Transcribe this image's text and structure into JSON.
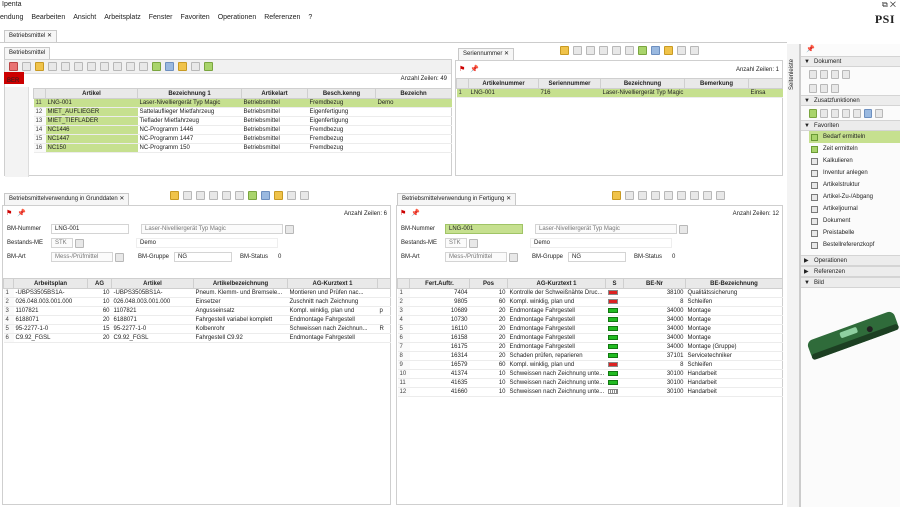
{
  "app": {
    "title": "Ipenta",
    "logo": "PSI"
  },
  "menu": [
    "endung",
    "Bearbeiten",
    "Ansicht",
    "Arbeitsplatz",
    "Fenster",
    "Favoriten",
    "Operationen",
    "Referenzen",
    "?"
  ],
  "main_tab": "Betriebsmittel",
  "top_left": {
    "subtab": "Betriebsmittel",
    "row_count": "Anzahl Zeilen: 49",
    "side_label": "BER",
    "columns": [
      "",
      "Artikel",
      "Bezeichnung 1",
      "Artikelart",
      "Besch.kenng",
      "Bezeichn"
    ],
    "rows": [
      {
        "n": "11",
        "a": "LNG-001",
        "b": "Laser-Nivelliergerät Typ Magic",
        "c": "Betriebsmittel",
        "d": "Fremdbezug",
        "e": "Demo",
        "sel": true
      },
      {
        "n": "12",
        "a": "MIET_AUFLIEGER",
        "b": "Sattelauflieger Mietfahrzeug",
        "c": "Betriebsmittel",
        "d": "Eigenfertigung",
        "e": ""
      },
      {
        "n": "13",
        "a": "MIET_TIEFLADER",
        "b": "Tieflader Mietfahrzeug",
        "c": "Betriebsmittel",
        "d": "Eigenfertigung",
        "e": ""
      },
      {
        "n": "14",
        "a": "NC1446",
        "b": "NC-Programm 1446",
        "c": "Betriebsmittel",
        "d": "Fremdbezug",
        "e": ""
      },
      {
        "n": "15",
        "a": "NC1447",
        "b": "NC-Programm 1447",
        "c": "Betriebsmittel",
        "d": "Fremdbezug",
        "e": ""
      },
      {
        "n": "16",
        "a": "NC150",
        "b": "NC-Programm 150",
        "c": "Betriebsmittel",
        "d": "Fremdbezug",
        "e": ""
      }
    ]
  },
  "top_right": {
    "subtab": "Seriennummer",
    "row_count": "Anzahl Zeilen: 1",
    "columns": [
      "",
      "Artikelnummer",
      "Seriennummer",
      "Bezeichnung",
      "Bemerkung",
      ""
    ],
    "rows": [
      {
        "n": "1",
        "a": "LNG-001",
        "b": "716",
        "c": "Laser-Nivelliergerät Typ Magic",
        "d": "",
        "e": "Einsa"
      }
    ]
  },
  "bottom_left": {
    "subtab": "Betriebsmittelverwendung in Grunddaten",
    "row_count": "Anzahl Zeilen: 6",
    "form": {
      "bm_nummer_label": "BM-Nummer",
      "bm_nummer": "LNG-001",
      "bez": "Laser-Nivelliergerät Typ Magic",
      "bestands_label": "Bestands-ME",
      "bestands": "STK",
      "demo": "Demo",
      "bm_art_label": "BM-Art",
      "bm_art": "Mess-/Prüfmittel",
      "bm_gruppe_label": "BM-Gruppe",
      "bm_gruppe": "NG",
      "bm_status_label": "BM-Status",
      "bm_status": "0"
    },
    "columns": [
      "",
      "Arbeitsplan",
      "AG",
      "Artikel",
      "Artikelbezeichnung",
      "AG-Kurztext 1",
      ""
    ],
    "rows": [
      {
        "n": "1",
        "a": "-UBPS3505BS1A-",
        "b": "10",
        "c": "-UBPS3505BS1A-",
        "d": "Pneum. Klemm- und Bremsele...",
        "e": "Montieren und Prüfen nac...",
        "f": ""
      },
      {
        "n": "2",
        "a": "026.048.003.001.000",
        "b": "10",
        "c": "026.048.003.001.000",
        "d": "Einsetzer",
        "e": "Zuschnitt nach Zeichnung",
        "f": ""
      },
      {
        "n": "3",
        "a": "1107821",
        "b": "60",
        "c": "1107821",
        "d": "Angusseinsatz",
        "e": "Kompl. winklig, plan und",
        "f": "p"
      },
      {
        "n": "4",
        "a": "6188071",
        "b": "20",
        "c": "6188071",
        "d": "Fahrgestell variabel komplett",
        "e": "Endmontage Fahrgestell",
        "f": ""
      },
      {
        "n": "5",
        "a": "95-2277-1-0",
        "b": "15",
        "c": "95-2277-1-0",
        "d": "Kolbenrohr",
        "e": "Schweissen nach Zeichnun...",
        "f": "R"
      },
      {
        "n": "6",
        "a": "C9.92_FGSL",
        "b": "20",
        "c": "C9.92_FGSL",
        "d": "Fahrgestell C9.92",
        "e": "Endmontage Fahrgestell",
        "f": ""
      }
    ]
  },
  "bottom_right": {
    "subtab": "Betriebsmittelverwendung in Fertigung",
    "row_count": "Anzahl Zeilen: 12",
    "form": {
      "bm_nummer_label": "BM-Nummer",
      "bm_nummer": "LNG-001",
      "bez": "Laser-Nivelliergerät Typ Magic",
      "bestands_label": "Bestands-ME",
      "bestands": "STK",
      "demo": "Demo",
      "bm_art_label": "BM-Art",
      "bm_art": "Mess-/Prüfmittel",
      "bm_gruppe_label": "BM-Gruppe",
      "bm_gruppe": "NG",
      "bm_status_label": "BM-Status",
      "bm_status": "0"
    },
    "columns": [
      "",
      "Fert.Auftr.",
      "Pos",
      "AG-Kurztext 1",
      "S",
      "BE-Nr",
      "BE-Bezeichnung"
    ],
    "rows": [
      {
        "n": "1",
        "a": "7404",
        "b": "10",
        "c": "Kontrolle der Schweißnähte Druc...",
        "s": "red",
        "d": "38100",
        "e": "Qualitätssicherung"
      },
      {
        "n": "2",
        "a": "9805",
        "b": "60",
        "c": "Kompl. winklig, plan und",
        "s": "red",
        "d": "8",
        "e": "Schleifen"
      },
      {
        "n": "3",
        "a": "10689",
        "b": "20",
        "c": "Endmontage Fahrgestell",
        "s": "grn",
        "d": "34000",
        "e": "Montage"
      },
      {
        "n": "4",
        "a": "10730",
        "b": "20",
        "c": "Endmontage Fahrgestell",
        "s": "grn",
        "d": "34000",
        "e": "Montage"
      },
      {
        "n": "5",
        "a": "16110",
        "b": "20",
        "c": "Endmontage Fahrgestell",
        "s": "grn",
        "d": "34000",
        "e": "Montage"
      },
      {
        "n": "6",
        "a": "16158",
        "b": "20",
        "c": "Endmontage Fahrgestell",
        "s": "grn",
        "d": "34000",
        "e": "Montage"
      },
      {
        "n": "7",
        "a": "16175",
        "b": "20",
        "c": "Endmontage Fahrgestell",
        "s": "grn",
        "d": "34000",
        "e": "Montage (Gruppe)"
      },
      {
        "n": "8",
        "a": "16314",
        "b": "20",
        "c": "Schaden prüfen, reparieren",
        "s": "grn",
        "d": "37101",
        "e": "Servicetechniker"
      },
      {
        "n": "9",
        "a": "16579",
        "b": "60",
        "c": "Kompl. winklig, plan und",
        "s": "red",
        "d": "8",
        "e": "Schleifen"
      },
      {
        "n": "10",
        "a": "41374",
        "b": "10",
        "c": "Schweissen nach Zeichnung unte...",
        "s": "grn",
        "d": "30100",
        "e": "Handarbeit"
      },
      {
        "n": "11",
        "a": "41635",
        "b": "10",
        "c": "Schweissen nach Zeichnung unte...",
        "s": "grn",
        "d": "30100",
        "e": "Handarbeit"
      },
      {
        "n": "12",
        "a": "41660",
        "b": "10",
        "c": "Schweissen nach Zeichnung unte...",
        "s": "bars",
        "d": "30100",
        "e": "Handarbeit"
      }
    ]
  },
  "sidebar": {
    "vtab": "Seitenleiste",
    "sections": {
      "dokument": "Dokument",
      "zusatz": "Zusatzfunktionen",
      "favoriten": "Favoriten",
      "operationen": "Operationen",
      "referenzen": "Referenzen",
      "bild": "Bild"
    },
    "favorites": [
      "Bedarf ermitteln",
      "Zeit ermitteln",
      "Kalkulieren",
      "Inventur anlegen",
      "Artikelstruktur",
      "Artikel-Zu-/Abgang",
      "Artikeljournal",
      "Dokument",
      "Preistabelle",
      "Bestellreferenzkopf"
    ]
  },
  "colors": {
    "selection": "#c6e08f",
    "status_red": "#dd2222",
    "status_green": "#22bb22"
  }
}
